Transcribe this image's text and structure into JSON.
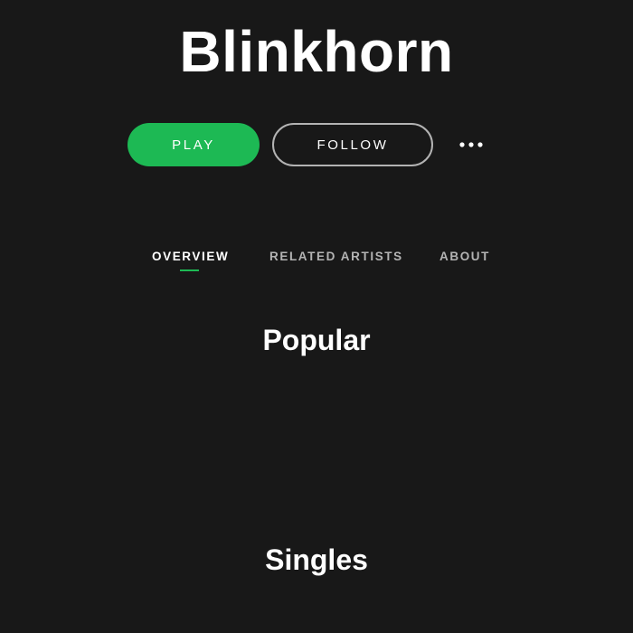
{
  "artist": {
    "name": "Blinkhorn"
  },
  "actions": {
    "play_label": "PLAY",
    "follow_label": "FOLLOW",
    "more_icon": "more-horizontal-icon"
  },
  "tabs": [
    {
      "label": "OVERVIEW",
      "active": true
    },
    {
      "label": "RELATED ARTISTS",
      "active": false
    },
    {
      "label": "ABOUT",
      "active": false
    }
  ],
  "sections": {
    "popular_title": "Popular",
    "singles_title": "Singles"
  },
  "colors": {
    "background": "#181818",
    "accent": "#1db954",
    "text": "#ffffff",
    "muted_text": "#b3b3b3"
  }
}
